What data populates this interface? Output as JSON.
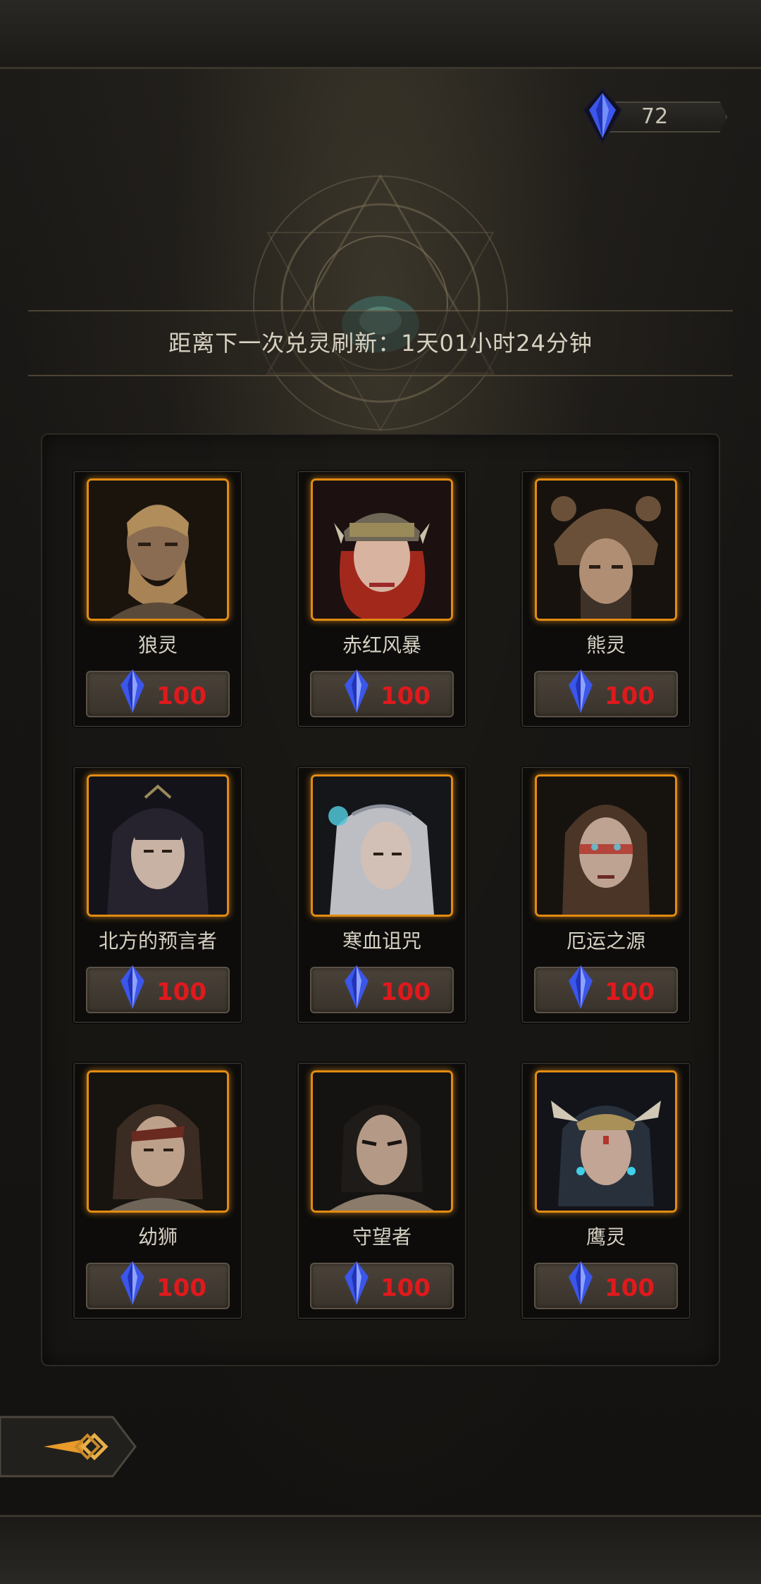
{
  "currency": {
    "icon": "blue-crystal-icon",
    "amount": "72"
  },
  "refresh": {
    "text": "距离下一次兑灵刷新：1天01小时24分钟"
  },
  "cards": [
    {
      "name": "狼灵",
      "price": "100",
      "icon": "crystal-icon"
    },
    {
      "name": "赤红风暴",
      "price": "100",
      "icon": "crystal-icon"
    },
    {
      "name": "熊灵",
      "price": "100",
      "icon": "crystal-icon"
    },
    {
      "name": "北方的预言者",
      "price": "100",
      "icon": "crystal-icon"
    },
    {
      "name": "寒血诅咒",
      "price": "100",
      "icon": "crystal-icon"
    },
    {
      "name": "厄运之源",
      "price": "100",
      "icon": "crystal-icon"
    },
    {
      "name": "幼狮",
      "price": "100",
      "icon": "crystal-icon"
    },
    {
      "name": "守望者",
      "price": "100",
      "icon": "crystal-icon"
    },
    {
      "name": "鹰灵",
      "price": "100",
      "icon": "crystal-icon"
    }
  ],
  "back_button": {
    "icon": "back-arrow-icon"
  },
  "colors": {
    "accent_orange": "#e28b12",
    "price_red": "#e0191d",
    "crystal_blue": "#3b56e8"
  }
}
